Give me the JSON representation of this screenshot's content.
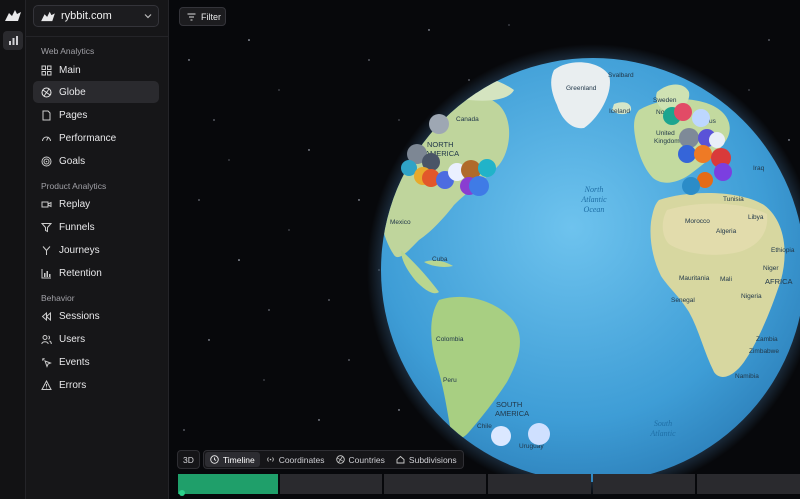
{
  "site": {
    "name": "rybbit.com"
  },
  "sidebar": {
    "sections": [
      {
        "title": "Web Analytics"
      },
      {
        "title": "Product Analytics"
      },
      {
        "title": "Behavior"
      }
    ],
    "items": [
      {
        "label": "Main"
      },
      {
        "label": "Globe"
      },
      {
        "label": "Pages"
      },
      {
        "label": "Performance"
      },
      {
        "label": "Goals"
      },
      {
        "label": "Replay"
      },
      {
        "label": "Funnels"
      },
      {
        "label": "Journeys"
      },
      {
        "label": "Retention"
      },
      {
        "label": "Sessions"
      },
      {
        "label": "Users"
      },
      {
        "label": "Events"
      },
      {
        "label": "Errors"
      }
    ],
    "active_item": "Globe"
  },
  "toolbar": {
    "filter_label": "Filter",
    "mode_3d": "3D",
    "views": [
      {
        "label": "Timeline",
        "active": true
      },
      {
        "label": "Coordinates",
        "active": false
      },
      {
        "label": "Countries",
        "active": false
      },
      {
        "label": "Subdivisions",
        "active": false
      }
    ]
  },
  "map": {
    "labels": {
      "canada": "Canada",
      "north_america_1": "NORTH",
      "north_america_2": "AMERICA",
      "mexico": "Mexico",
      "cuba": "Cuba",
      "colombia": "Colombia",
      "peru": "Peru",
      "south_america_1": "SOUTH",
      "south_america_2": "AMERICA",
      "chile": "Chile",
      "uruguay": "Uruguay",
      "greenland": "Greenland",
      "iceland": "Iceland",
      "svalbard": "Svalbard",
      "sweden": "Sweden",
      "united_kingdom_1": "United",
      "united_kingdom_2": "Kingdom",
      "north_atlantic_1": "North",
      "north_atlantic_2": "Atlantic",
      "north_atlantic_3": "Ocean",
      "south_atlantic_1": "South",
      "south_atlantic_2": "Atlantic",
      "morocco": "Morocco",
      "algeria": "Algeria",
      "tunisia": "Tunisia",
      "libya": "Libya",
      "iraq": "Iraq",
      "mauritania": "Mauritania",
      "mali": "Mali",
      "niger": "Niger",
      "senegal": "Senegal",
      "nigeria": "Nigeria",
      "ethiopia": "Ethiopia",
      "africa": "AFRICA",
      "zambia": "Zambia",
      "zimbabwe": "Zimbabwe",
      "namibia": "Namibia",
      "no": "No",
      "us": "us"
    }
  },
  "timeline": {
    "progress": 0.16,
    "segment_count": 6
  },
  "colors": {
    "accent": "#1f9f6a",
    "ocean": "#4aa6dc",
    "land": "#bfd9a2"
  }
}
